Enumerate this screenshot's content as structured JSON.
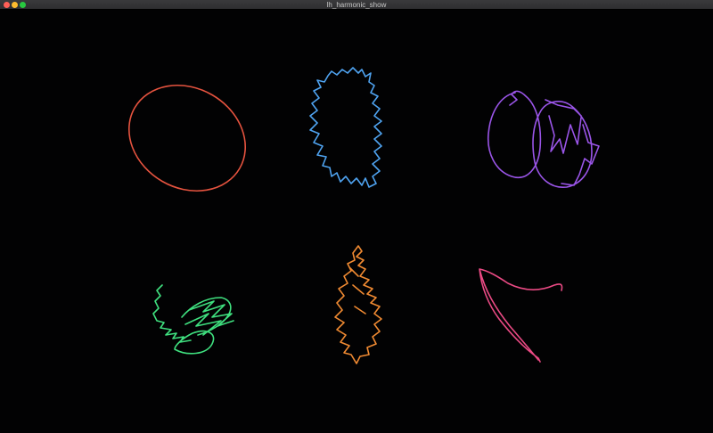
{
  "window": {
    "title": "lh_harmonic_show",
    "controls": {
      "close_color": "#ff5f57",
      "minimize_color": "#febc2e",
      "zoom_color": "#28c840"
    }
  },
  "canvas": {
    "background": "#020203",
    "shapes": [
      {
        "name": "shape-red-ellipse",
        "color": "#e5533f"
      },
      {
        "name": "shape-blue-blob",
        "color": "#4fa3f0"
      },
      {
        "name": "shape-purple-loops",
        "color": "#9a55e8"
      },
      {
        "name": "shape-green-scribble",
        "color": "#3fe07f"
      },
      {
        "name": "shape-orange-feather",
        "color": "#f08a32"
      },
      {
        "name": "shape-pink-curve",
        "color": "#ea4a84"
      }
    ]
  }
}
